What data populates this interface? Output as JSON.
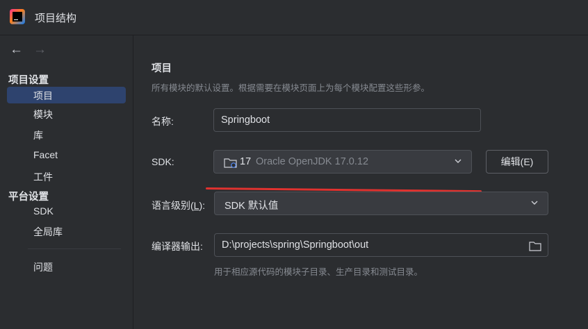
{
  "window": {
    "title": "项目结构"
  },
  "sidebar": {
    "groups": [
      {
        "heading": "项目设置",
        "items": [
          "项目",
          "模块",
          "库",
          "Facet",
          "工件"
        ]
      },
      {
        "heading": "平台设置",
        "items": [
          "SDK",
          "全局库"
        ]
      }
    ],
    "problems": "问题",
    "selected": "项目"
  },
  "project": {
    "title": "项目",
    "description": "所有模块的默认设置。根据需要在模块页面上为每个模块配置这些形参。",
    "name_label": "名称:",
    "name_value": "Springboot",
    "sdk_label": "SDK:",
    "sdk_version": "17",
    "sdk_name": "Oracle OpenJDK 17.0.12",
    "edit_button": "编辑(E)",
    "language_level_label_pre": "语言级别(",
    "language_level_mnemonic": "L",
    "language_level_label_post": "):",
    "language_level_value": "SDK 默认值",
    "compiler_output_label": "编译器输出:",
    "compiler_output_value": "D:\\projects\\spring\\Springboot\\out",
    "compiler_output_hint": "用于相应源代码的模块子目录、生产目录和测试目录。"
  },
  "colors": {
    "background": "#2b2d30",
    "selection": "#2e436e",
    "annotation_underline": "#e0322f",
    "muted_text": "#868a91"
  },
  "icons": [
    "jetbrains-app-icon",
    "arrow-left-icon",
    "arrow-right-icon",
    "folder-icon",
    "chevron-down-icon"
  ]
}
